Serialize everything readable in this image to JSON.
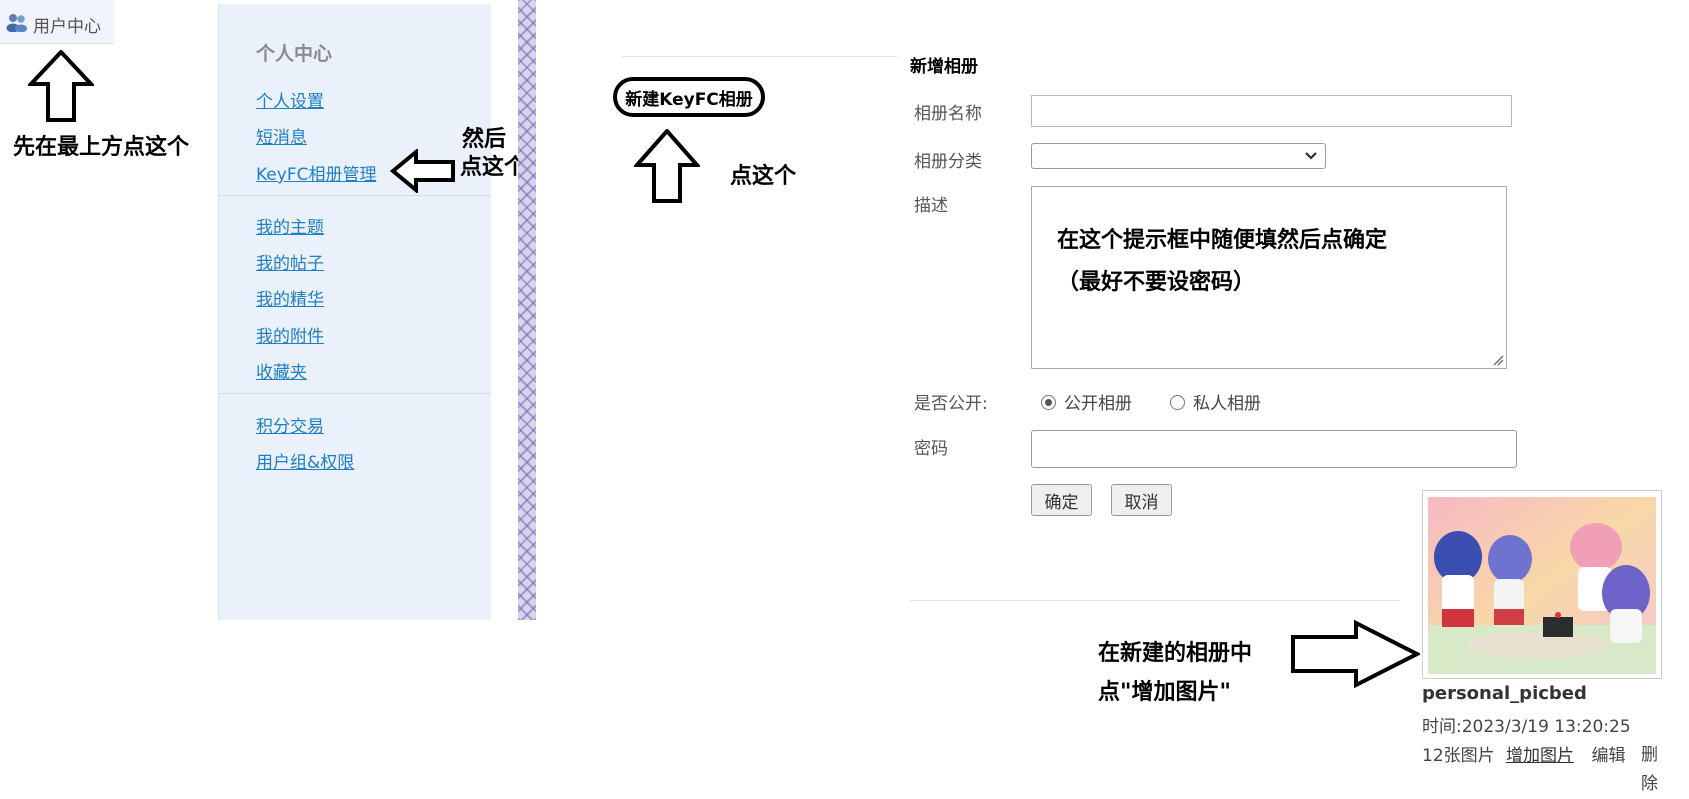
{
  "header": {
    "user_center": "用户中心"
  },
  "annotations": {
    "step1": "先在最上方点这个",
    "step2_line1": "然后",
    "step2_line2": "点这个",
    "step3": "点这个",
    "step4": "在这个提示框中随便填然后点确定",
    "step4_note": "（最好不要设密码）",
    "step5_line1": "在新建的相册中",
    "step5_line2": "点\"增加图片\""
  },
  "sidebar": {
    "title": "个人中心",
    "group1": [
      "个人设置",
      "短消息",
      "KeyFC相册管理"
    ],
    "group2": [
      "我的主题",
      "我的帖子",
      "我的精华",
      "我的附件",
      "收藏夹"
    ],
    "group3": [
      "积分交易",
      "用户组&权限"
    ]
  },
  "album_panel": {
    "new_album_button": "新建KeyFC相册"
  },
  "form": {
    "title": "新增相册",
    "name_label": "相册名称",
    "name_value": "",
    "category_label": "相册分类",
    "category_value": "",
    "desc_label": "描述",
    "public_label": "是否公开:",
    "public_option": "公开相册",
    "private_option": "私人相册",
    "selected": "公开相册",
    "password_label": "密码",
    "password_value": "",
    "ok_button": "确定",
    "cancel_button": "取消"
  },
  "album": {
    "name": "personal_picbed",
    "time": "时间:2023/3/19 13:20:25",
    "count": "12张图片",
    "add_photo": "增加图片",
    "edit": "编辑",
    "delete": "删除"
  },
  "colors": {
    "sidebar_bg": "#eaf1fa",
    "link": "#1e7fc4",
    "lattice": "#d9d3ec"
  }
}
